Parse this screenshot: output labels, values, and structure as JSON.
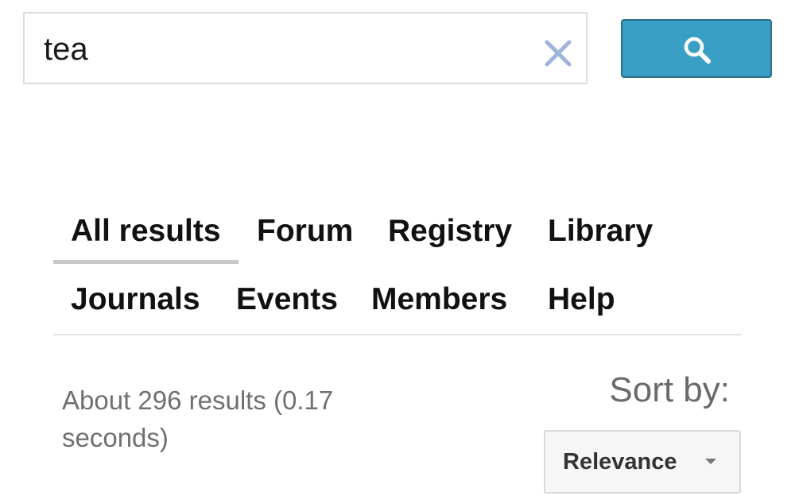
{
  "search": {
    "value": "tea",
    "clear_icon": "close-icon",
    "button_icon": "search-icon",
    "button_color": "#3a9fc4"
  },
  "tabs": [
    {
      "label": "All results",
      "active": true
    },
    {
      "label": "Forum",
      "active": false
    },
    {
      "label": "Registry",
      "active": false
    },
    {
      "label": "Library",
      "active": false
    },
    {
      "label": "Journals",
      "active": false
    },
    {
      "label": "Events",
      "active": false
    },
    {
      "label": "Members",
      "active": false
    },
    {
      "label": "Help",
      "active": false
    }
  ],
  "results": {
    "summary": "About 296 results (0.17 seconds)"
  },
  "sort": {
    "label": "Sort by:",
    "selected": "Relevance"
  }
}
